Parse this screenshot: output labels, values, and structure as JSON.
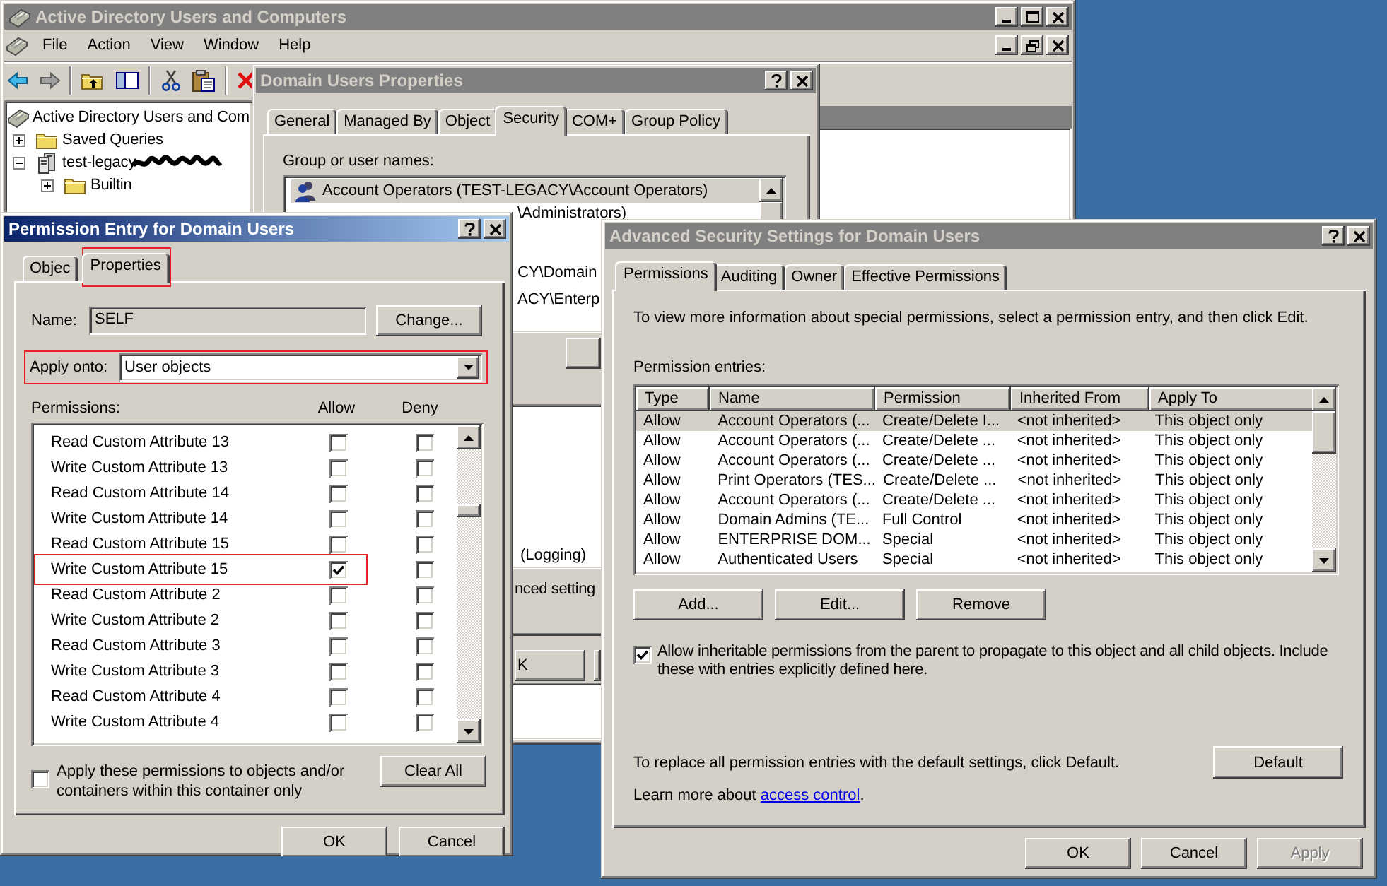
{
  "main_window": {
    "title": "Active Directory Users and Computers",
    "active": false,
    "menu": [
      "File",
      "Action",
      "View",
      "Window",
      "Help"
    ],
    "tree": [
      {
        "label": "Active Directory Users and Com",
        "kind": "root",
        "children": [
          {
            "label": "Saved Queries",
            "kind": "folder",
            "expanded": false
          },
          {
            "label": "test-legacy",
            "kind": "domain",
            "expanded": true,
            "redacted": true,
            "children": [
              {
                "label": "Builtin",
                "kind": "folder",
                "expanded": false
              }
            ]
          }
        ]
      }
    ]
  },
  "properties_dialog": {
    "title": "Domain Users Properties",
    "active": false,
    "tabs": [
      {
        "label": "General",
        "selected": false
      },
      {
        "label": "Managed By",
        "selected": false
      },
      {
        "label": "Object",
        "selected": false
      },
      {
        "label": "Security",
        "selected": true
      },
      {
        "label": "COM+",
        "selected": false
      },
      {
        "label": "Group Policy",
        "selected": false
      }
    ],
    "group_label": "Group or user names:",
    "names": [
      {
        "name": "Account Operators (TEST-LEGACY\\Account Operators)",
        "selected": true
      },
      {
        "name": "\\Administrators)",
        "selected": false
      },
      {
        "name": "CY\\Domain",
        "selected": false
      },
      {
        "name": "ACY\\Enterp",
        "selected": false
      }
    ],
    "permission_row": "(Logging)",
    "info_text": "nced setting",
    "ok_button": "K"
  },
  "permission_entry": {
    "title": "Permission Entry for Domain Users",
    "active": true,
    "tabs": [
      {
        "label": "Objec",
        "selected": false,
        "highlighted": false
      },
      {
        "label": "Properties",
        "selected": true,
        "highlighted": true
      }
    ],
    "name_label": "Name:",
    "name_value": "SELF",
    "change_button": "Change...",
    "apply_label": "Apply onto:",
    "apply_value": "User objects",
    "apply_highlighted": true,
    "permissions_label": "Permissions:",
    "allow_header": "Allow",
    "deny_header": "Deny",
    "permissions": [
      {
        "name": "Read Custom Attribute 13",
        "allow": false,
        "deny": false,
        "highlighted": false
      },
      {
        "name": "Write Custom Attribute 13",
        "allow": false,
        "deny": false,
        "highlighted": false
      },
      {
        "name": "Read Custom Attribute 14",
        "allow": false,
        "deny": false,
        "highlighted": false
      },
      {
        "name": "Write Custom Attribute 14",
        "allow": false,
        "deny": false,
        "highlighted": false
      },
      {
        "name": "Read Custom Attribute 15",
        "allow": false,
        "deny": false,
        "highlighted": false
      },
      {
        "name": "Write Custom Attribute 15",
        "allow": true,
        "deny": false,
        "highlighted": true
      },
      {
        "name": "Read Custom Attribute 2",
        "allow": false,
        "deny": false,
        "highlighted": false
      },
      {
        "name": "Write Custom Attribute 2",
        "allow": false,
        "deny": false,
        "highlighted": false
      },
      {
        "name": "Read Custom Attribute 3",
        "allow": false,
        "deny": false,
        "highlighted": false
      },
      {
        "name": "Write Custom Attribute 3",
        "allow": false,
        "deny": false,
        "highlighted": false
      },
      {
        "name": "Read Custom Attribute 4",
        "allow": false,
        "deny": false,
        "highlighted": false
      },
      {
        "name": "Write Custom Attribute 4",
        "allow": false,
        "deny": false,
        "highlighted": false
      }
    ],
    "container_only": {
      "label": "Apply these permissions to objects and/or containers within this container only",
      "checked": false
    },
    "clear_button": "Clear All",
    "ok_button": "OK",
    "cancel_button": "Cancel"
  },
  "advanced_security": {
    "title": "Advanced Security Settings for Domain Users",
    "active": false,
    "tabs": [
      {
        "label": "Permissions",
        "selected": true
      },
      {
        "label": "Auditing",
        "selected": false
      },
      {
        "label": "Owner",
        "selected": false
      },
      {
        "label": "Effective Permissions",
        "selected": false
      }
    ],
    "intro": "To view more information about special permissions, select a permission entry, and then click Edit.",
    "entries_label": "Permission entries:",
    "columns": [
      "Type",
      "Name",
      "Permission",
      "Inherited From",
      "Apply To"
    ],
    "rows": [
      {
        "cells": [
          "Allow",
          "Account Operators (...",
          "Create/Delete I...",
          "<not inherited>",
          "This object only"
        ],
        "selected": true
      },
      {
        "cells": [
          "Allow",
          "Account Operators (...",
          "Create/Delete ...",
          "<not inherited>",
          "This object only"
        ],
        "selected": false
      },
      {
        "cells": [
          "Allow",
          "Account Operators (...",
          "Create/Delete ...",
          "<not inherited>",
          "This object only"
        ],
        "selected": false
      },
      {
        "cells": [
          "Allow",
          "Print Operators (TES...",
          "Create/Delete ...",
          "<not inherited>",
          "This object only"
        ],
        "selected": false
      },
      {
        "cells": [
          "Allow",
          "Account Operators (...",
          "Create/Delete ...",
          "<not inherited>",
          "This object only"
        ],
        "selected": false
      },
      {
        "cells": [
          "Allow",
          "Domain Admins (TE...",
          "Full Control",
          "<not inherited>",
          "This object only"
        ],
        "selected": false
      },
      {
        "cells": [
          "Allow",
          "ENTERPRISE DOM...",
          "Special",
          "<not inherited>",
          "This object only"
        ],
        "selected": false
      },
      {
        "cells": [
          "Allow",
          "Authenticated Users",
          "Special",
          "<not inherited>",
          "This object only"
        ],
        "selected": false
      }
    ],
    "buttons": [
      "Add...",
      "Edit...",
      "Remove"
    ],
    "inherit": {
      "label": "Allow inheritable permissions from the parent to propagate to this object and all child objects. Include these with entries explicitly defined here.",
      "checked": true
    },
    "default_text": "To replace all permission entries with the default settings, click Default.",
    "default_button": "Default",
    "learn_prefix": "Learn more about ",
    "learn_link": "access control",
    "learn_suffix": ".",
    "footer_buttons": [
      {
        "label": "OK",
        "disabled": false
      },
      {
        "label": "Cancel",
        "disabled": false
      },
      {
        "label": "Apply",
        "disabled": true
      }
    ]
  }
}
